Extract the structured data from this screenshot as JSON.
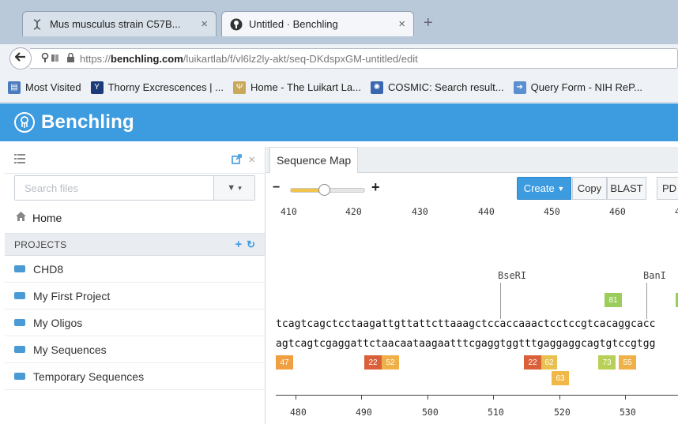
{
  "browser": {
    "tabs": [
      {
        "title": "Mus musculus strain C57B...",
        "active": false,
        "icon": "dna-icon"
      },
      {
        "title": "Untitled · Benchling",
        "active": true,
        "icon": "benchling-favicon"
      }
    ],
    "url_prefix": "https://",
    "url_host": "benchling.com",
    "url_path": "/luikartlab/f/vl6lz2ly-akt/seq-DKdspxGM-untitled/edit",
    "bookmarks": [
      {
        "label": "Most Visited",
        "icon": "bookmark-folder-icon",
        "color": "#4b7bbd"
      },
      {
        "label": "Thorny Excrescences | ...",
        "icon": "yale-icon",
        "color": "#1d3a7a"
      },
      {
        "label": "Home - The Luikart La...",
        "icon": "lab-icon",
        "color": "#c8a85a"
      },
      {
        "label": "COSMIC: Search result...",
        "icon": "cosmic-icon",
        "color": "#3a68b0"
      },
      {
        "label": "Query Form - NIH ReP...",
        "icon": "form-icon",
        "color": "#5a8fd0"
      }
    ]
  },
  "app": {
    "brand": "Benchling",
    "header_color": "#3d9be0"
  },
  "sidebar": {
    "search_placeholder": "Search files",
    "home_label": "Home",
    "projects_header": "PROJECTS",
    "projects": [
      "CHD8",
      "My First Project",
      "My Oligos",
      "My Sequences",
      "Temporary Sequences"
    ]
  },
  "main": {
    "tab_label": "Sequence Map",
    "zoom_level": 0.45,
    "buttons": {
      "create": "Create",
      "copy": "Copy",
      "blast": "BLAST",
      "pd": "PD"
    },
    "top_ruler": [
      "410",
      "420",
      "430",
      "440",
      "450",
      "460",
      "4"
    ],
    "enzymes": [
      {
        "name": "BseRI"
      },
      {
        "name": "BanI"
      }
    ],
    "sequence_top": "tcagtcagctcctaagattgttattcttaaagctccaccaaactcctccgtcacaggcacc",
    "sequence_bottom": "agtcagtcgaggattctaacaataagaatttcgaggtggtttgaggaggcagtgtccgtgg",
    "badges_above": [
      {
        "value": "81",
        "color": "#9acd5a"
      }
    ],
    "badges_below": [
      {
        "value": "47",
        "color": "#f0a040"
      },
      {
        "value": "22",
        "color": "#d9603a"
      },
      {
        "value": "52",
        "color": "#f0b048"
      },
      {
        "value": "22",
        "color": "#d9603a"
      },
      {
        "value": "62",
        "color": "#e8c050"
      },
      {
        "value": "63",
        "color": "#f0b848"
      },
      {
        "value": "73",
        "color": "#b8d058"
      },
      {
        "value": "55",
        "color": "#f0b048"
      }
    ],
    "bottom_ruler": [
      "480",
      "490",
      "500",
      "510",
      "520",
      "530"
    ]
  }
}
